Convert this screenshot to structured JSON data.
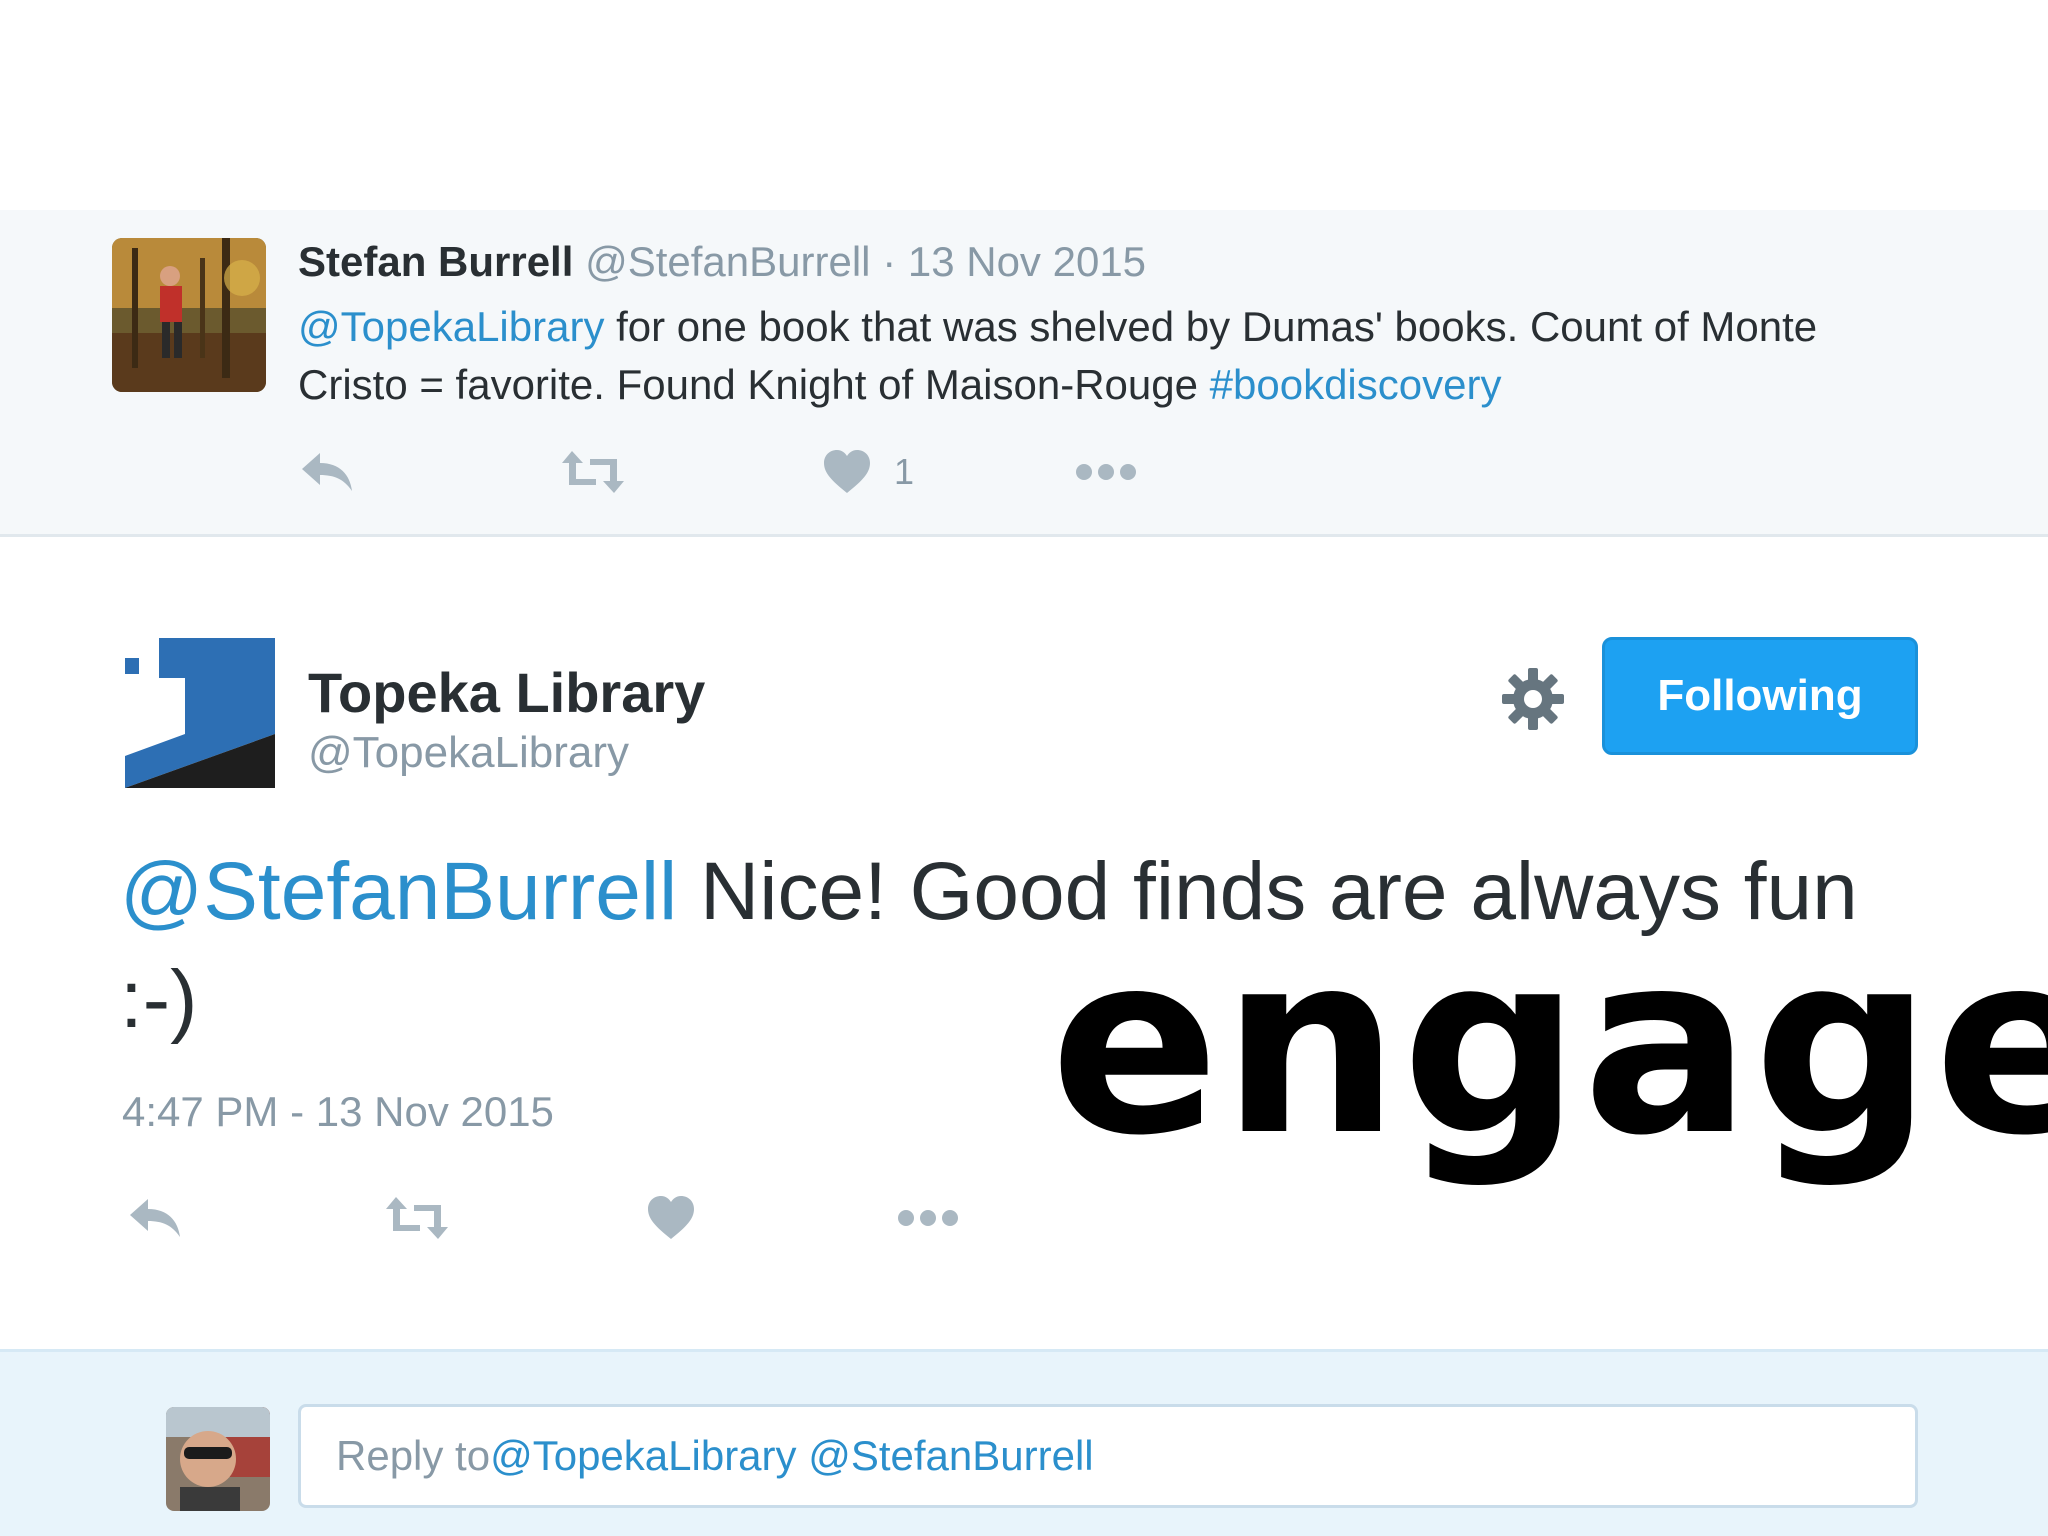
{
  "parent_tweet": {
    "author_name": "Stefan Burrell",
    "author_handle": "@StefanBurrell",
    "separator": "·",
    "date": "13 Nov 2015",
    "text_mention": "@TopekaLibrary",
    "text_body": " for one book that was shelved by Dumas' books. Count of Monte Cristo = favorite. Found Knight of Maison-Rouge ",
    "text_hashtag": "#bookdiscovery",
    "like_count": "1",
    "icons": [
      "reply-icon",
      "retweet-icon",
      "heart-icon",
      "more-icon"
    ]
  },
  "focused_tweet": {
    "author_name": "Topeka Library",
    "author_handle": "@TopekaLibrary",
    "follow_button_label": "Following",
    "text_mention": "@StefanBurrell",
    "text_body": " Nice! Good finds are always fun :-)",
    "timestamp": "4:47 PM - 13 Nov 2015",
    "icons": [
      "gear-icon",
      "reply-icon",
      "retweet-icon",
      "heart-icon",
      "more-icon"
    ]
  },
  "overlay_word": "engage",
  "reply_box": {
    "prefix": "Reply to ",
    "mention_1": "@TopekaLibrary",
    "mention_2": "@StefanBurrell"
  },
  "colors": {
    "link": "#2b8fcc",
    "button_blue": "#1da1f2",
    "muted_gray": "#8899a6",
    "icon_gray": "#aab8c2"
  }
}
